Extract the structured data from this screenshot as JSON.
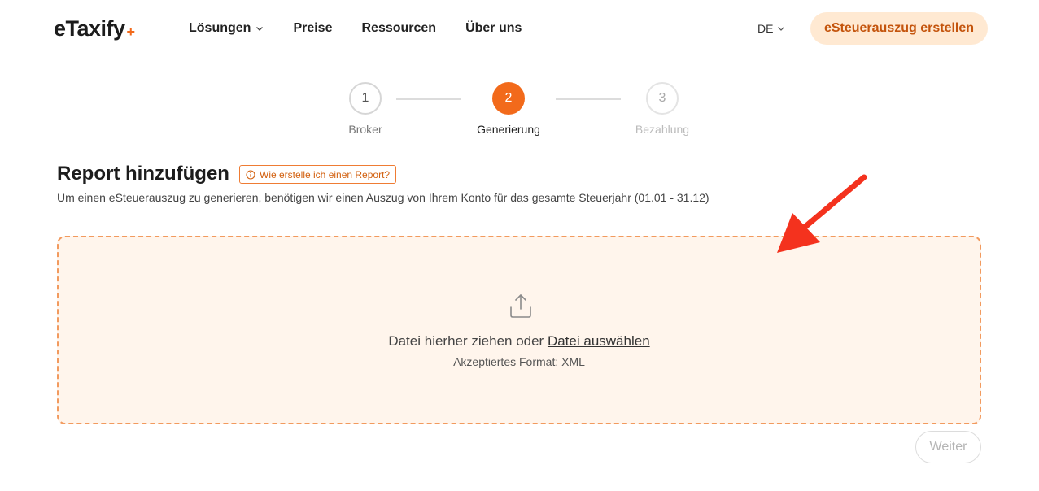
{
  "header": {
    "logo_text": "eTaxify",
    "logo_plus": "+",
    "nav": [
      {
        "label": "Lösungen",
        "has_dropdown": true
      },
      {
        "label": "Preise",
        "has_dropdown": false
      },
      {
        "label": "Ressourcen",
        "has_dropdown": false
      },
      {
        "label": "Über uns",
        "has_dropdown": false
      }
    ],
    "language": "DE",
    "cta_label": "eSteuerauszug erstellen"
  },
  "stepper": {
    "steps": [
      {
        "number": "1",
        "label": "Broker",
        "state": "completed"
      },
      {
        "number": "2",
        "label": "Generierung",
        "state": "active"
      },
      {
        "number": "3",
        "label": "Bezahlung",
        "state": "upcoming"
      }
    ]
  },
  "report": {
    "title": "Report hinzufügen",
    "help_label": "Wie erstelle ich einen Report?",
    "subtitle": "Um einen eSteuerauszug zu generieren, benötigen wir einen Auszug von Ihrem Konto für das gesamte Steuerjahr (01.01 - 31.12)"
  },
  "dropzone": {
    "icon": "upload-icon",
    "text_prefix": "Datei hierher ziehen oder ",
    "link_text": "Datei auswählen",
    "format_text": "Akzeptiertes Format: XML"
  },
  "actions": {
    "next_label": "Weiter"
  },
  "colors": {
    "accent": "#f26a1b",
    "cta_bg": "#ffe9d2",
    "dropzone_bg": "#fff5ec",
    "annotation_arrow": "#f4321e"
  }
}
